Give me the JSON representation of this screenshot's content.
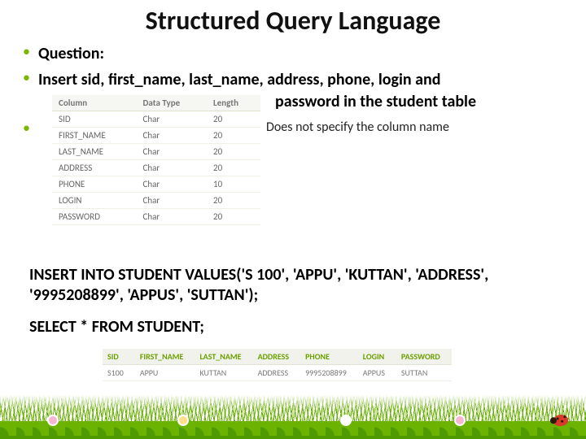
{
  "title": "Structured Query Language",
  "bullets": {
    "question_label": "Question:",
    "insert_line": "Insert sid, first_name, last_name, address, phone, login and",
    "insert_line_2": "password in the student table",
    "note_line": "Does not specify the column name"
  },
  "schema": {
    "headers": [
      "Column",
      "Data Type",
      "Length"
    ],
    "rows": [
      {
        "col": "SID",
        "type": "Char",
        "len": "20"
      },
      {
        "col": "FIRST_NAME",
        "type": "Char",
        "len": "20"
      },
      {
        "col": "LAST_NAME",
        "type": "Char",
        "len": "20"
      },
      {
        "col": "ADDRESS",
        "type": "Char",
        "len": "20"
      },
      {
        "col": "PHONE",
        "type": "Char",
        "len": "10"
      },
      {
        "col": "LOGIN",
        "type": "Char",
        "len": "20"
      },
      {
        "col": "PASSWORD",
        "type": "Char",
        "len": "20"
      }
    ]
  },
  "sql": {
    "insert": "INSERT INTO STUDENT VALUES('S 100', 'APPU', 'KUTTAN', 'ADDRESS', '9995208899', 'APPUS', 'SUTTAN');",
    "select": "SELECT * FROM STUDENT;"
  },
  "result": {
    "headers": [
      "SID",
      "FIRST_NAME",
      "LAST_NAME",
      "ADDRESS",
      "PHONE",
      "LOGIN",
      "PASSWORD"
    ],
    "row": {
      "sid": "S100",
      "first": "APPU",
      "last": "KUTTAN",
      "addr": "ADDRESS",
      "phone": "9995208899",
      "login": "APPUS",
      "pass": "SUTTAN"
    }
  }
}
